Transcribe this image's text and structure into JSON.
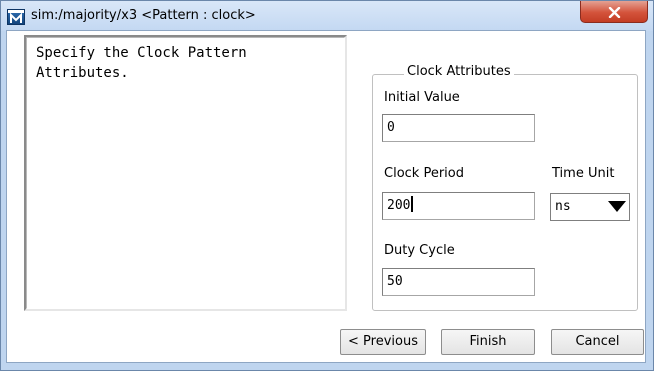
{
  "window": {
    "title": "sim:/majority/x3 <Pattern : clock>",
    "icon": "modelsim-m-icon",
    "close_icon": "close-x-icon"
  },
  "description": {
    "text": "Specify the Clock Pattern\nAttributes."
  },
  "clock_attributes": {
    "group_title": "Clock Attributes",
    "initial_value": {
      "label": "Initial Value",
      "value": "0"
    },
    "clock_period": {
      "label": "Clock Period",
      "value": "200"
    },
    "time_unit": {
      "label": "Time Unit",
      "value": "ns"
    },
    "duty_cycle": {
      "label": "Duty Cycle",
      "value": "50"
    }
  },
  "buttons": {
    "previous": "< Previous",
    "finish": "Finish",
    "cancel": "Cancel"
  },
  "colors": {
    "frame": "#bfd5ef",
    "close_button": "#d4533b"
  }
}
